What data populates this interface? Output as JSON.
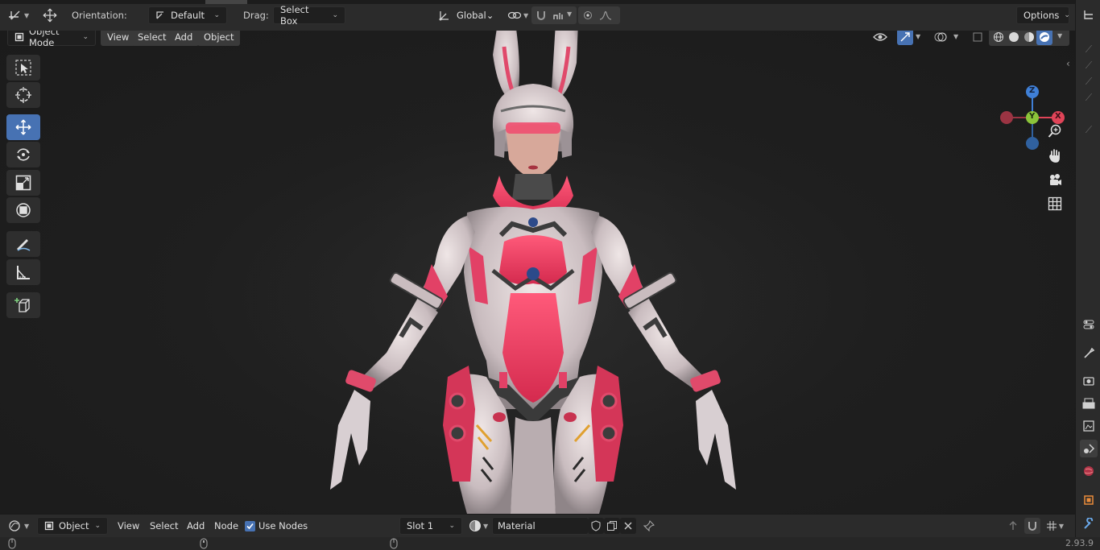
{
  "header": {
    "orientation_label": "Orientation:",
    "orientation_value": "Default",
    "drag_label": "Drag:",
    "drag_value": "Select Box",
    "transform_space": "Global",
    "options_label": "Options"
  },
  "viewport_header": {
    "mode": "Object Mode",
    "menus": [
      "View",
      "Select",
      "Add",
      "Object"
    ]
  },
  "toolbar": {
    "tools": [
      "select-box",
      "cursor",
      "move",
      "rotate",
      "scale",
      "transform",
      "annotate",
      "measure",
      "add-cube"
    ],
    "active_tool": "move"
  },
  "gizmo": {
    "axes": [
      "Z",
      "Y",
      "X"
    ],
    "colors": {
      "x": "#e04458",
      "y": "#8cc43a",
      "z": "#3f7fd6",
      "x_neg": "#9b3443",
      "z_neg": "#30619f"
    }
  },
  "navigation": [
    "zoom-icon",
    "hand-pan-icon",
    "camera-icon",
    "grid-icon"
  ],
  "shader_editor": {
    "editor_type": "Object",
    "menus": [
      "View",
      "Select",
      "Add",
      "Node"
    ],
    "use_nodes_label": "Use Nodes",
    "use_nodes_checked": true,
    "slot": "Slot 1",
    "material_name": "Material"
  },
  "status": {
    "version": "2.93.9"
  },
  "properties_tabs": [
    "tool",
    "render",
    "output",
    "view-layer",
    "scene",
    "world",
    "object",
    "modifiers"
  ],
  "accent_color": "#4772b3"
}
